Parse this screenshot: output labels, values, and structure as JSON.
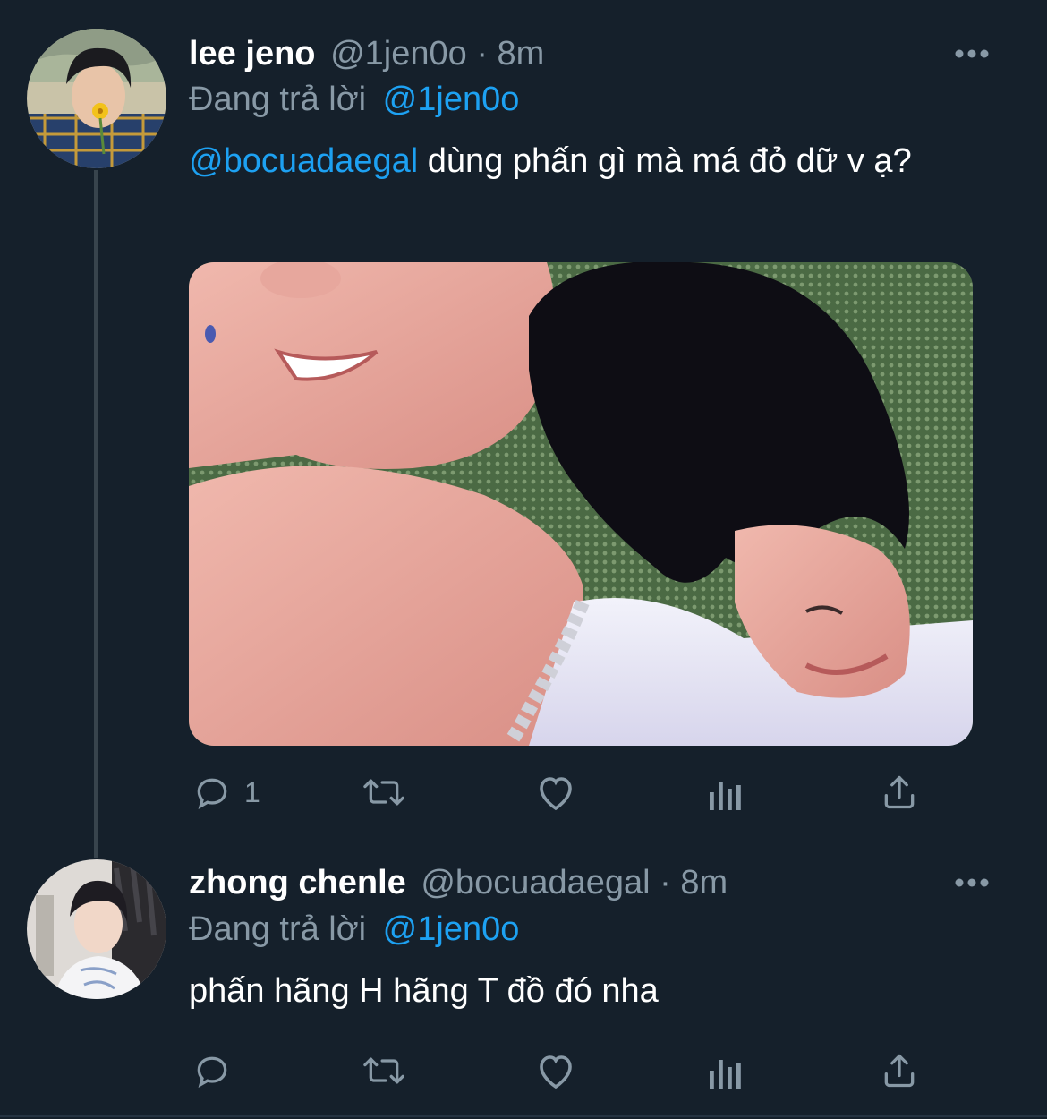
{
  "tweets": [
    {
      "name": "lee jeno",
      "handle": "@1jen0o",
      "separator": "·",
      "time": "8m",
      "reply_prefix": "Đang trả lời",
      "reply_to": "@1jen0o",
      "mention": "@bocuadaegal",
      "text": " dùng phấn gì mà má đỏ dữ v ạ?",
      "reply_count": "1",
      "media_description": "photo"
    },
    {
      "name": "zhong chenle",
      "handle": "@bocuadaegal",
      "separator": "·",
      "time": "8m",
      "reply_prefix": "Đang trả lời",
      "reply_to": "@1jen0o",
      "text": "phấn hãng H hãng T đồ đó nha"
    }
  ],
  "icons": {
    "reply": "reply-icon",
    "retweet": "retweet-icon",
    "like": "heart-icon",
    "analytics": "analytics-icon",
    "share": "share-icon",
    "more": "more-icon"
  },
  "colors": {
    "background": "#15202b",
    "link": "#1da1f2",
    "secondary_text": "#8899a6",
    "thread_line": "#38444d"
  }
}
